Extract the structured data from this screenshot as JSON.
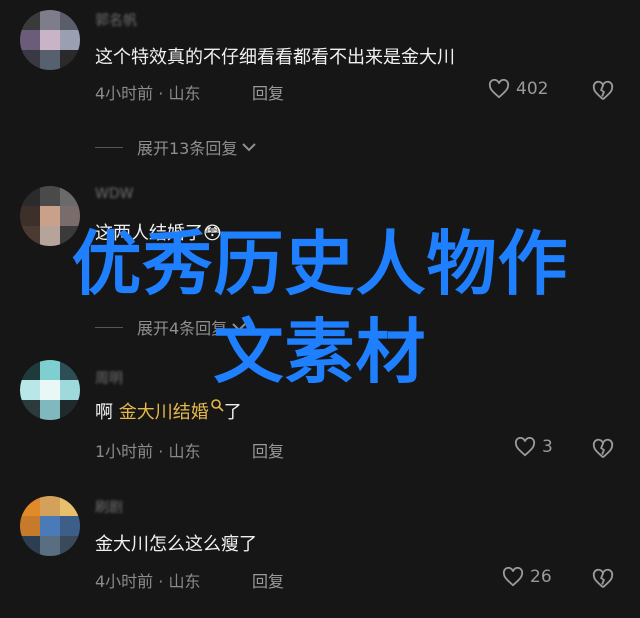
{
  "comments": [
    {
      "username": "郭名帆",
      "text": "这个特效真的不仔细看看都看不出来是金大川",
      "time": "4小时前",
      "location": "山东",
      "reply_label": "回复",
      "likes": "402",
      "expand_label": "展开13条回复"
    },
    {
      "username": "WDW",
      "text": "这两人结婚了",
      "emoji": "😳",
      "time": "",
      "location": "",
      "reply_label": "",
      "likes": "",
      "expand_label": "展开4条回复"
    },
    {
      "username": "周明",
      "text_prefix": "啊",
      "link_text": "金大川结婚",
      "text_suffix": "了",
      "time": "1小时前",
      "location": "山东",
      "reply_label": "回复",
      "likes": "3"
    },
    {
      "username": "刷剧",
      "text": "金大川怎么这么瘦了",
      "time": "4小时前",
      "location": "山东",
      "reply_label": "回复",
      "likes": "26"
    }
  ],
  "overlay": {
    "line1": "优秀历史人物作",
    "line2": "文素材"
  },
  "colors": {
    "background": "#161616",
    "overlay_text": "#1e7fff",
    "link": "#e6b84a"
  }
}
